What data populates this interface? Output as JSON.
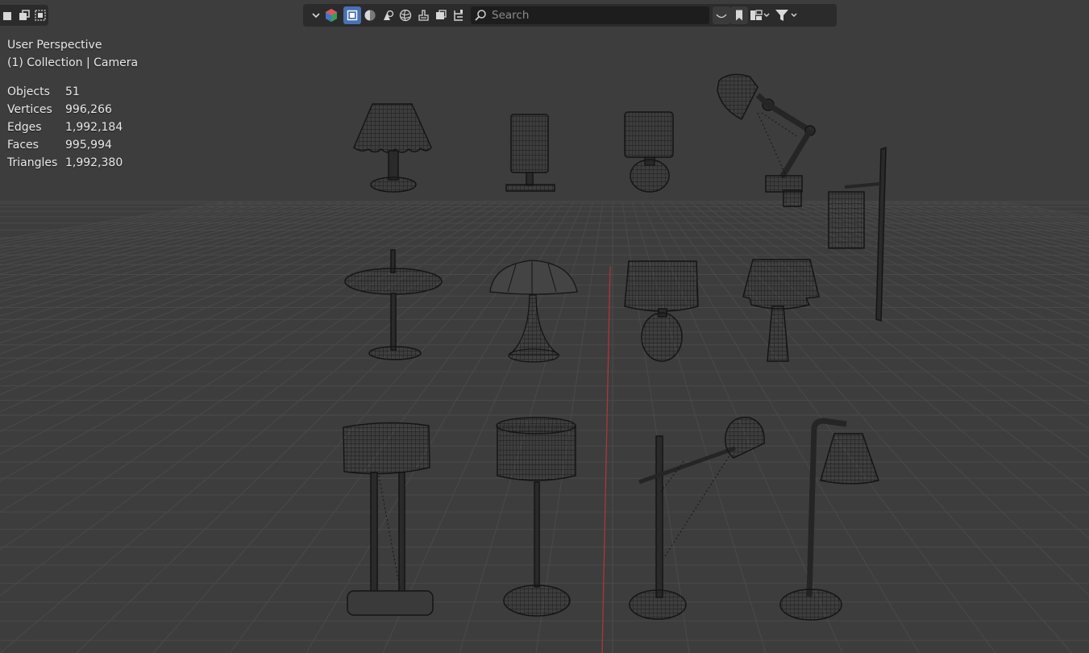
{
  "toolbar": {
    "search_placeholder": "Search",
    "accent_color": "#4772b3",
    "icons": [
      "selection-mode-icons",
      "view-object-types-icon",
      "solid-object-icon",
      "solid-shading-icon",
      "material-shading-icon",
      "render-shading-icon",
      "xray-icon",
      "overlay-icon",
      "gizmo-icon",
      "search-icon",
      "filter-icon",
      "bookmark-icon",
      "layout-icon"
    ]
  },
  "overlay": {
    "view_name": "User Perspective",
    "collection_camera": "(1) Collection | Camera",
    "stats": [
      {
        "label": "Objects",
        "value": "51"
      },
      {
        "label": "Vertices",
        "value": "996,266"
      },
      {
        "label": "Edges",
        "value": "1,992,184"
      },
      {
        "label": "Faces",
        "value": "995,994"
      },
      {
        "label": "Triangles",
        "value": "1,992,380"
      }
    ]
  },
  "scene": {
    "background_color": "#3d3d3d",
    "grid_color": "#4a4a4a",
    "axis_color": "#c0393b",
    "objects": [
      "table-lamp-scalloped",
      "table-lamp-cylinder",
      "table-lamp-drum-ball",
      "desk-lamp-arm",
      "wall-lamp",
      "table-lamp-mushroom-disc",
      "table-lamp-dome",
      "table-lamp-ribbed-base",
      "table-lamp-tiered",
      "floor-lamp-box",
      "floor-lamp-drum",
      "floor-lamp-arm",
      "floor-lamp-arc"
    ]
  }
}
